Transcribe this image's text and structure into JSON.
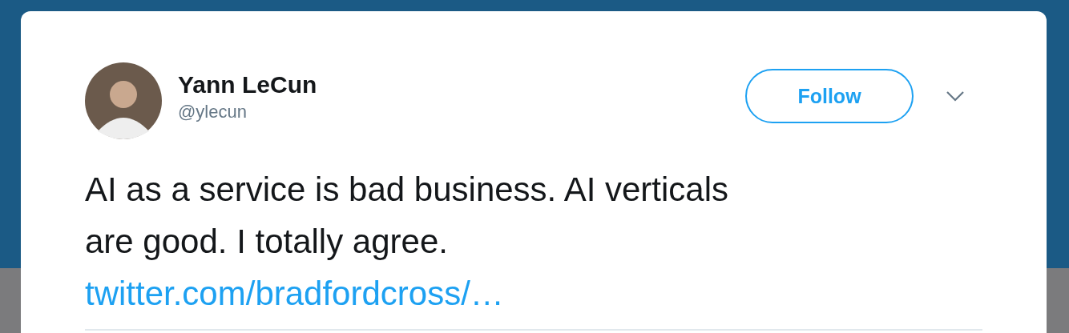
{
  "tweet": {
    "author": {
      "name": "Yann LeCun",
      "handle": "@ylecun"
    },
    "follow_button": {
      "label": "Follow"
    },
    "text_lines": [
      "AI as a service is bad business. AI verticals",
      "are good. I totally agree."
    ],
    "link": "twitter.com/bradfordcross/…"
  }
}
